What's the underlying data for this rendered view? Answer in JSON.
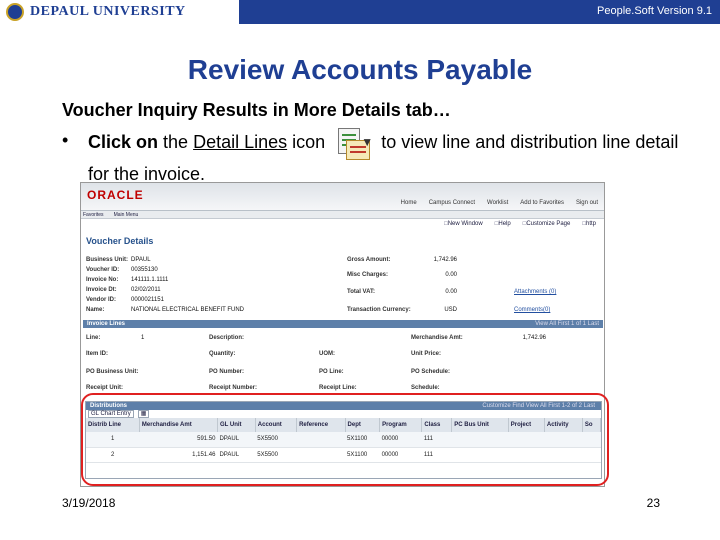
{
  "banner": {
    "logo_text": "DEPAUL UNIVERSITY",
    "version": "People.Soft Version 9.1",
    "bg_color": "#1f3f93"
  },
  "slide": {
    "title": "Review Accounts Payable",
    "subheading": "Voucher Inquiry Results in More Details tab…",
    "bullet_symbol": "•",
    "bullet_click_on": "Click on",
    "bullet_the": "the",
    "bullet_detail_lines": "Detail Lines",
    "bullet_icon_word": "icon",
    "bullet_rest": "to view line and distribution line detail for the invoice.",
    "icon_name": "detail-lines-icon"
  },
  "screenshot": {
    "brand": "ORACLE",
    "header_links": [
      "Home",
      "Campus Connect",
      "Worklist",
      "Add to Favorites",
      "Sign out"
    ],
    "menu": [
      "Favorites",
      "Main Menu"
    ],
    "toolbar": [
      "New Window",
      "Help",
      "Customize Page",
      "http"
    ],
    "page_title": "Voucher Details",
    "left_fields": [
      {
        "label": "Business Unit:",
        "value": "DPAUL"
      },
      {
        "label": "Voucher ID:",
        "value": "00355130"
      },
      {
        "label": "Invoice No:",
        "value": "141111.1.1111"
      },
      {
        "label": "Invoice Dt:",
        "value": "02/02/2011"
      },
      {
        "label": "Vendor ID:",
        "value": "0000021151"
      },
      {
        "label": "Name:",
        "value": "NATIONAL ELECTRICAL BENEFIT FUND"
      }
    ],
    "right_fields": [
      {
        "label": "Gross Amount:",
        "value": "1,742.96"
      },
      {
        "label": "Misc Charges:",
        "value": "0.00"
      },
      {
        "label": "Total VAT:",
        "value": "0.00"
      },
      {
        "label": "Transaction Currency:",
        "value": "USD"
      }
    ],
    "right_links": [
      "Attachments (0)",
      "Comments(0)"
    ],
    "invoice_lines_label": "Invoice Lines",
    "invoice_lines_nav": "View All  First  1 of 1  Last",
    "line_fields": [
      {
        "label": "Line:",
        "value": "1"
      },
      {
        "label": "Item ID:",
        "value": ""
      },
      {
        "label": "PO Business Unit:",
        "value": ""
      },
      {
        "label": "Receipt Unit:",
        "value": ""
      }
    ],
    "line_fields_mid": [
      "Description:",
      "Quantity:",
      "PO Number:",
      "Receipt Number:"
    ],
    "line_fields_mid2": [
      "UOM:",
      "PO Line:",
      "Receipt Line:"
    ],
    "line_fields_right": [
      {
        "label": "Merchandise Amt:",
        "value": "1,742.96"
      },
      {
        "label": "Unit Price:",
        "value": ""
      },
      {
        "label": "PO Schedule:",
        "value": ""
      },
      {
        "label": "Schedule:",
        "value": ""
      }
    ],
    "distributions": {
      "label": "Distributions",
      "nav": "Customize  Find  View All  First  1-2 of 2  Last",
      "tab": "GL Chart Entry",
      "columns": [
        "Distrib Line",
        "Merchandise Amt",
        "GL Unit",
        "Account",
        "Reference",
        "Dept",
        "Program",
        "Class",
        "PC Bus Unit",
        "Project",
        "Activity",
        "So"
      ],
      "rows": [
        [
          "1",
          "591.50",
          "DPAUL",
          "5X5500",
          "",
          "5X1100",
          "00000",
          "111",
          "",
          "",
          "",
          ""
        ],
        [
          "2",
          "1,151.46",
          "DPAUL",
          "5X5500",
          "",
          "5X1100",
          "00000",
          "111",
          "",
          "",
          "",
          ""
        ]
      ]
    }
  },
  "highlight_color": "#e02020",
  "footer": {
    "date": "3/19/2018",
    "page_number": "23"
  }
}
